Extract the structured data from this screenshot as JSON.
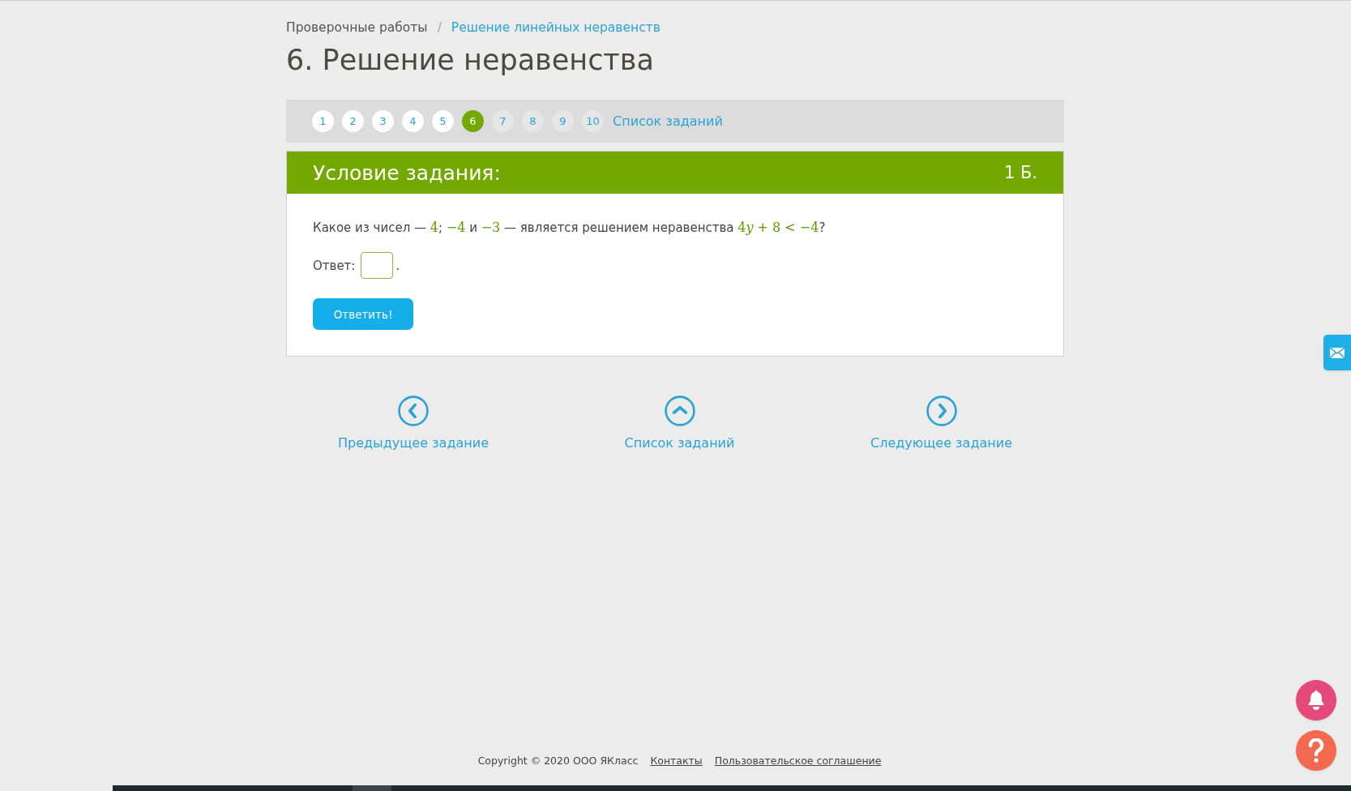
{
  "breadcrumbs": [
    {
      "label": "Проверочные работы",
      "link": false
    },
    {
      "label": "Решение линейных неравенств",
      "link": true
    }
  ],
  "breadcrumb_separator": "/",
  "title": "6. Решение неравенства",
  "pagination": {
    "pages": [
      {
        "label": "1",
        "selected": false,
        "visited": true
      },
      {
        "label": "2",
        "selected": false,
        "visited": true
      },
      {
        "label": "3",
        "selected": false,
        "visited": true
      },
      {
        "label": "4",
        "selected": false,
        "visited": true
      },
      {
        "label": "5",
        "selected": false,
        "visited": true
      },
      {
        "label": "6",
        "selected": true,
        "visited": true
      },
      {
        "label": "7",
        "selected": false,
        "visited": false
      },
      {
        "label": "8",
        "selected": false,
        "visited": false
      },
      {
        "label": "9",
        "selected": false,
        "visited": false
      },
      {
        "label": "10",
        "selected": false,
        "visited": false
      }
    ],
    "list_link": "Список заданий"
  },
  "task": {
    "header": "Условие задания:",
    "points": "1 Б.",
    "question": [
      {
        "kind": "text",
        "text": "Какое из чисел — "
      },
      {
        "kind": "math",
        "text": "4"
      },
      {
        "kind": "text",
        "text": "; "
      },
      {
        "kind": "math",
        "text": "−4"
      },
      {
        "kind": "text",
        "text": " и "
      },
      {
        "kind": "math",
        "text": "−3"
      },
      {
        "kind": "text",
        "text": " — является решением неравенства "
      },
      {
        "kind": "math",
        "text": "4"
      },
      {
        "kind": "variable",
        "text": "y"
      },
      {
        "kind": "math",
        "text": " + 8 < −4"
      },
      {
        "kind": "text",
        "text": "?"
      }
    ],
    "answer_label": "Ответ:",
    "answer_suffix": ".",
    "submit": "Ответить!"
  },
  "navigation": [
    {
      "kind": "prev",
      "label": "Предыдущее задание"
    },
    {
      "kind": "up",
      "label": "Список заданий"
    },
    {
      "kind": "next",
      "label": "Следующее задание"
    }
  ],
  "footer": {
    "copyright": "Copyright © 2020 ООО ЯКласс",
    "links": [
      "Контакты",
      "Пользовательское соглашение"
    ]
  }
}
